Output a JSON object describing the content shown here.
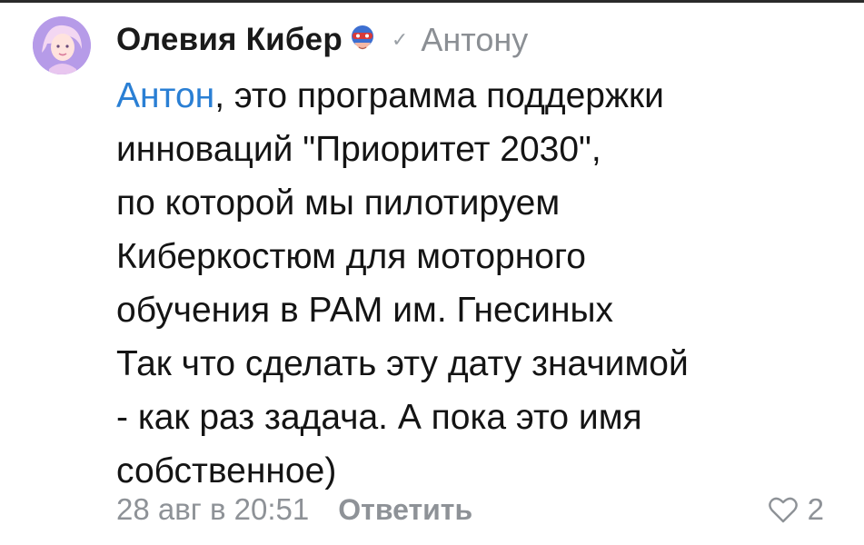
{
  "comment": {
    "author": "Олевия Кибер",
    "reply_to": "Антону",
    "mention": "Антон",
    "text_lines": [
      ", это программа поддержки",
      "инноваций \"Приоритет 2030\",",
      "по которой мы пилотируем",
      "Киберкостюм для моторного",
      "обучения в РАМ им. Гнесиных",
      "Так что сделать эту дату значимой",
      "- как раз задача. А пока это имя",
      "собственное)"
    ],
    "date": "28 авг в 20:51",
    "reply_label": "Ответить",
    "likes": "2",
    "icons": {
      "avatar": "user-avatar",
      "badge": "superhero-mask-icon",
      "reply_indicator": "check-icon",
      "like": "heart-icon"
    },
    "colors": {
      "mention": "#2a7fd4",
      "secondary_text": "#8e9297",
      "primary_text": "#141414"
    }
  }
}
